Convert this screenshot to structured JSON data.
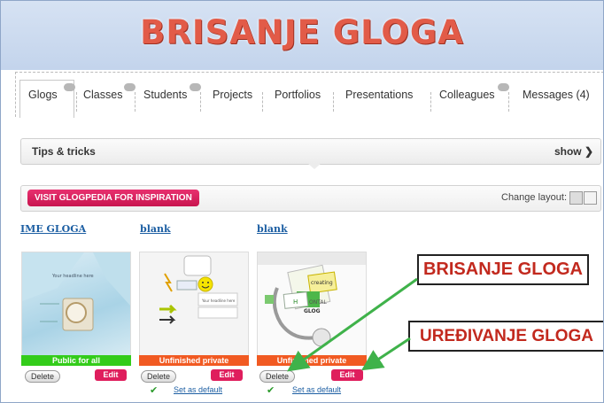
{
  "banner": {
    "title": "BRISANJE GLOGA"
  },
  "tabs": [
    {
      "label": "Glogs",
      "badge": ""
    },
    {
      "label": "Classes",
      "badge": ""
    },
    {
      "label": "Students",
      "badge": ""
    },
    {
      "label": "Projects",
      "badge": ""
    },
    {
      "label": "Portfolios",
      "badge": ""
    },
    {
      "label": "Presentations",
      "badge": ""
    },
    {
      "label": "Colleagues",
      "badge": ""
    },
    {
      "label": "Messages (4)",
      "badge": ""
    }
  ],
  "tips": {
    "label": "Tips & tricks",
    "toggle": "show ❯"
  },
  "toolbar": {
    "visit_label": "VISIT GLOGPEDIA FOR INSPIRATION",
    "change_layout_label": "Change layout:"
  },
  "glogs": [
    {
      "title": "IME GLOGA",
      "status": "Public for all",
      "status_color": "#33cc1a",
      "delete_label": "Delete",
      "edit_label": "Edit",
      "set_default": ""
    },
    {
      "title": "blank",
      "status": "Unfinished private",
      "status_color": "#f15a22",
      "delete_label": "Delete",
      "edit_label": "Edit",
      "set_default": "Set as default"
    },
    {
      "title": "blank",
      "status": "Unfinished private",
      "status_color": "#f15a22",
      "delete_label": "Delete",
      "edit_label": "Edit",
      "set_default": "Set as default"
    }
  ],
  "thumb_text": {
    "headline": "Your headline here",
    "creating": "creating",
    "glog_word": "GLOG",
    "ontal": "ONTAL"
  },
  "callouts": {
    "delete": "BRISANJE GLOGA",
    "edit": "UREĐIVANJE GLOGA"
  },
  "colors": {
    "banner_title": "#e25b48",
    "accent_pink": "#df1e5d",
    "arrow_green": "#3fb24a",
    "link_blue": "#1d5fa3"
  }
}
